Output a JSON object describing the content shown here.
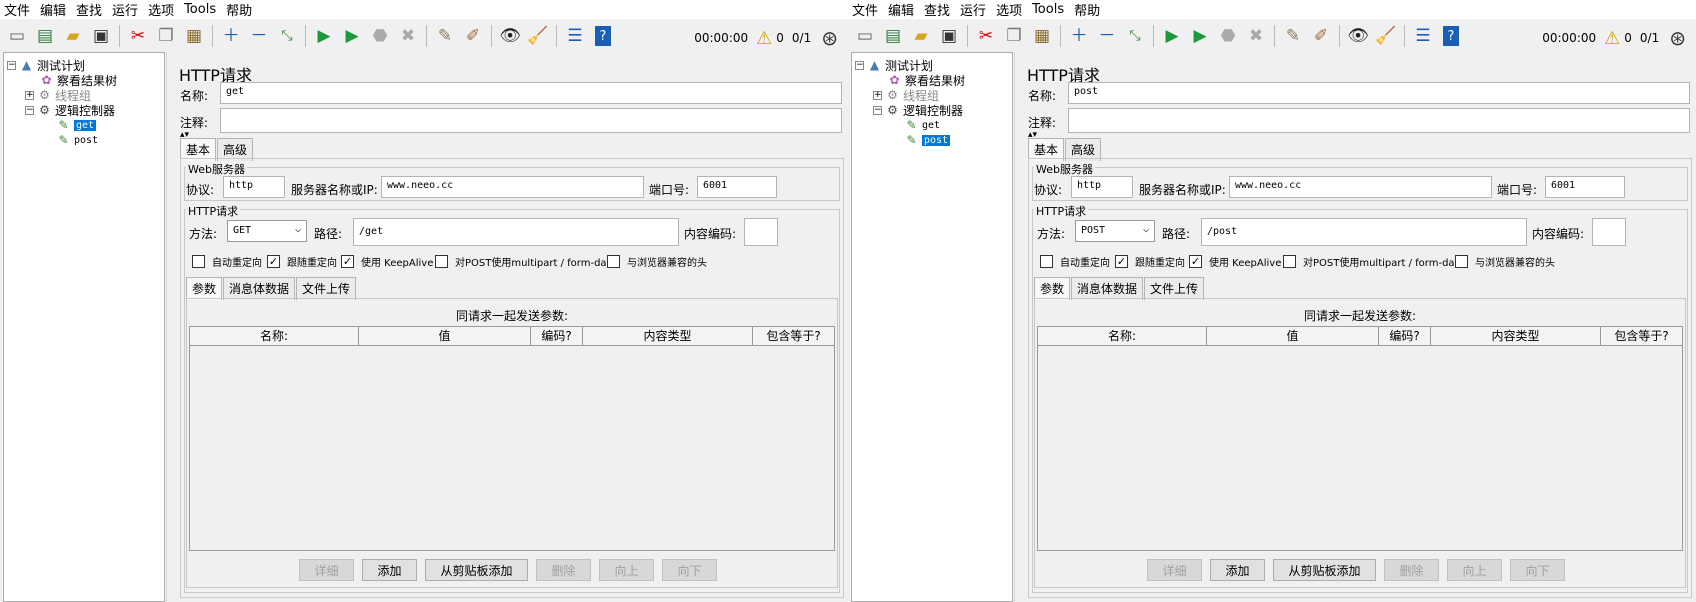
{
  "menu": [
    "文件",
    "编辑",
    "查找",
    "运行",
    "选项",
    "Tools",
    "帮助"
  ],
  "toolbar": {
    "timer": "00:00:00",
    "warnings": "0",
    "threads": "0/1"
  },
  "windows": [
    {
      "tree": {
        "plan": "测试计划",
        "viewer": "察看结果树",
        "thread_group": "线程组",
        "logic": "逻辑控制器",
        "get": "get",
        "post": "post"
      },
      "editor": {
        "title": "HTTP请求",
        "name_label": "名称:",
        "name_value": "get",
        "comment_label": "注释:",
        "tab_basic": "基本",
        "tab_advanced": "高级",
        "web_server_title": "Web服务器",
        "protocol_label": "协议:",
        "protocol_value": "http",
        "server_label": "服务器名称或IP:",
        "server_value": "www.neeo.cc",
        "port_label": "端口号:",
        "port_value": "6001",
        "http_title": "HTTP请求",
        "method_label": "方法:",
        "method_value": "GET",
        "path_label": "路径:",
        "path_value": "/get",
        "encoding_label": "内容编码:",
        "cb_auto_redirect": "自动重定向",
        "cb_follow_redirect": "跟随重定向",
        "cb_keepalive": "使用 KeepAlive",
        "cb_multipart": "对POST使用multipart / form-data",
        "cb_browser_headers": "与浏览器兼容的头",
        "tab_params": "参数",
        "tab_body": "消息体数据",
        "tab_files": "文件上传",
        "params_caption": "同请求一起发送参数:",
        "col_name": "名称:",
        "col_value": "值",
        "col_encode": "编码?",
        "col_type": "内容类型",
        "col_include": "包含等于?",
        "btn_detail": "详细",
        "btn_add": "添加",
        "btn_clipboard": "从剪贴板添加",
        "btn_delete": "删除",
        "btn_up": "向上",
        "btn_down": "向下"
      }
    },
    {
      "tree": {
        "plan": "测试计划",
        "viewer": "察看结果树",
        "thread_group": "线程组",
        "logic": "逻辑控制器",
        "get": "get",
        "post": "post"
      },
      "editor": {
        "title": "HTTP请求",
        "name_label": "名称:",
        "name_value": "post",
        "comment_label": "注释:",
        "tab_basic": "基本",
        "tab_advanced": "高级",
        "web_server_title": "Web服务器",
        "protocol_label": "协议:",
        "protocol_value": "http",
        "server_label": "服务器名称或IP:",
        "server_value": "www.neeo.cc",
        "port_label": "端口号:",
        "port_value": "6001",
        "http_title": "HTTP请求",
        "method_label": "方法:",
        "method_value": "POST",
        "path_label": "路径:",
        "path_value": "/post",
        "encoding_label": "内容编码:",
        "cb_auto_redirect": "自动重定向",
        "cb_follow_redirect": "跟随重定向",
        "cb_keepalive": "使用 KeepAlive",
        "cb_multipart": "对POST使用multipart / form-data",
        "cb_browser_headers": "与浏览器兼容的头",
        "tab_params": "参数",
        "tab_body": "消息体数据",
        "tab_files": "文件上传",
        "params_caption": "同请求一起发送参数:",
        "col_name": "名称:",
        "col_value": "值",
        "col_encode": "编码?",
        "col_type": "内容类型",
        "col_include": "包含等于?",
        "btn_detail": "详细",
        "btn_add": "添加",
        "btn_clipboard": "从剪贴板添加",
        "btn_delete": "删除",
        "btn_up": "向上",
        "btn_down": "向下"
      }
    }
  ]
}
